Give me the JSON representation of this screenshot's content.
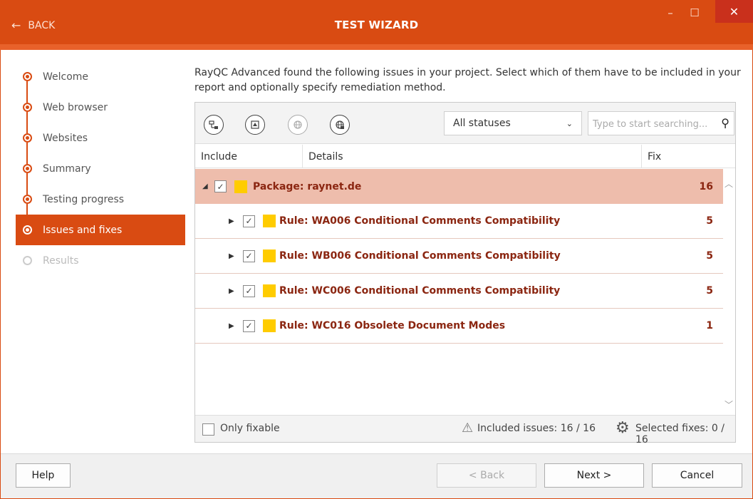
{
  "window": {
    "back_label": "BACK",
    "title": "TEST WIZARD",
    "minimize_glyph": "–",
    "maximize_glyph": "☐",
    "close_glyph": "✕"
  },
  "sidebar": {
    "steps": [
      {
        "label": "Welcome",
        "state": "done"
      },
      {
        "label": "Web browser",
        "state": "done"
      },
      {
        "label": "Websites",
        "state": "done"
      },
      {
        "label": "Summary",
        "state": "done"
      },
      {
        "label": "Testing progress",
        "state": "done"
      },
      {
        "label": "Issues and fixes",
        "state": "active"
      },
      {
        "label": "Results",
        "state": "disabled"
      }
    ]
  },
  "intro_text": "RayQC Advanced found the following issues in your project. Select which of them have to be included in your report and optionally specify remediation method.",
  "toolbar": {
    "filter_selected": "All statuses",
    "search_placeholder": "Type to start searching..."
  },
  "grid": {
    "columns": [
      "Include",
      "Details",
      "Fix"
    ],
    "rows": [
      {
        "type": "package",
        "label": "Package: raynet.de",
        "count": "16",
        "checked": true,
        "expanded": true
      },
      {
        "type": "rule",
        "label": "Rule: WA006 Conditional Comments Compatibility",
        "count": "5",
        "checked": true,
        "expanded": false
      },
      {
        "type": "rule",
        "label": "Rule: WB006 Conditional Comments Compatibility",
        "count": "5",
        "checked": true,
        "expanded": false
      },
      {
        "type": "rule",
        "label": "Rule: WC006 Conditional Comments Compatibility",
        "count": "5",
        "checked": true,
        "expanded": false
      },
      {
        "type": "rule",
        "label": "Rule: WC016 Obsolete Document Modes",
        "count": "1",
        "checked": true,
        "expanded": false
      }
    ]
  },
  "footer": {
    "only_fixable_label": "Only fixable",
    "included_issues": "Included issues: 16 / 16",
    "selected_fixes": "Selected fixes: 0 / 16"
  },
  "buttons": {
    "help": "Help",
    "back": "< Back",
    "next": "Next >",
    "cancel": "Cancel"
  },
  "colors": {
    "accent": "#d94b12",
    "package_row": "#eebdac",
    "swatch": "#ffcc00",
    "row_text": "#8b2611"
  },
  "icons": {
    "toolbar": [
      "collapse-tree-icon",
      "expand-tree-icon",
      "web-disabled-icon",
      "web-fix-icon"
    ]
  }
}
